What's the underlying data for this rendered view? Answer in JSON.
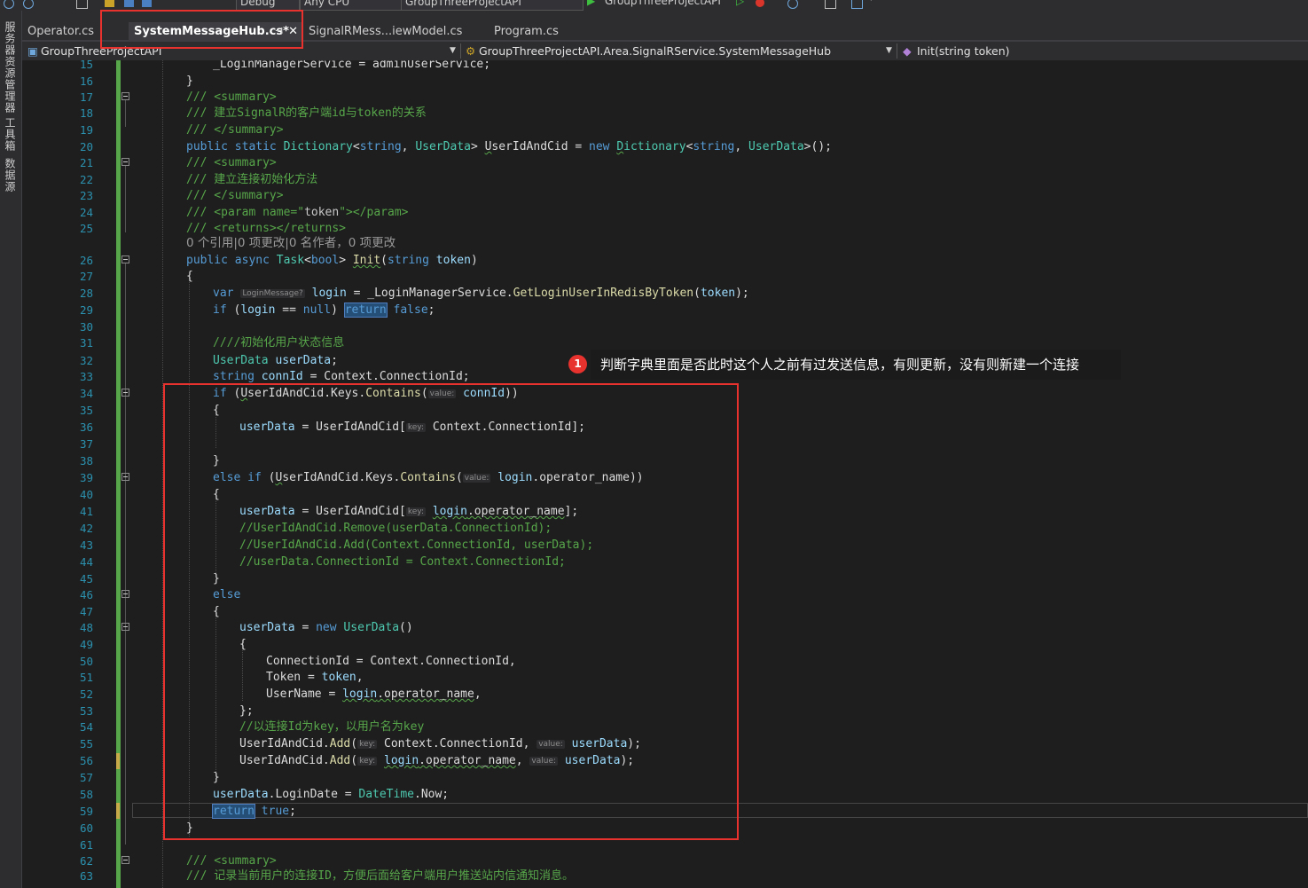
{
  "toolbar": {
    "config": "Debug",
    "platform": "Any CPU",
    "startup_project": "GroupThreeProjectAPI",
    "run_target": "GroupThreeProjectAPI"
  },
  "side_panel": {
    "items": [
      "服务器资源管理器",
      "工具箱",
      "数据源"
    ]
  },
  "tabs": [
    {
      "label": "Operator.cs",
      "active": false
    },
    {
      "label": "SystemMessageHub.cs*",
      "active": true
    },
    {
      "label": "SignalRMess...iewModel.cs",
      "active": false
    },
    {
      "label": "Program.cs",
      "active": false
    }
  ],
  "nav": {
    "project": "GroupThreeProjectAPI",
    "type": "GroupThreeProjectAPI.Area.SignalRService.SystemMessageHub",
    "member": "Init(string token)"
  },
  "codelens": "0 个引用|0 项更改|0 名作者，0 项更改",
  "annotation": {
    "badge": "1",
    "text": "判断字典里面是否此时这个人之前有过发送信息，有则更新，没有则新建一个连接"
  },
  "colors": {
    "accent_red": "#e8322e",
    "change_bar": "#57a64a",
    "editor_bg": "#1e1e1e"
  }
}
